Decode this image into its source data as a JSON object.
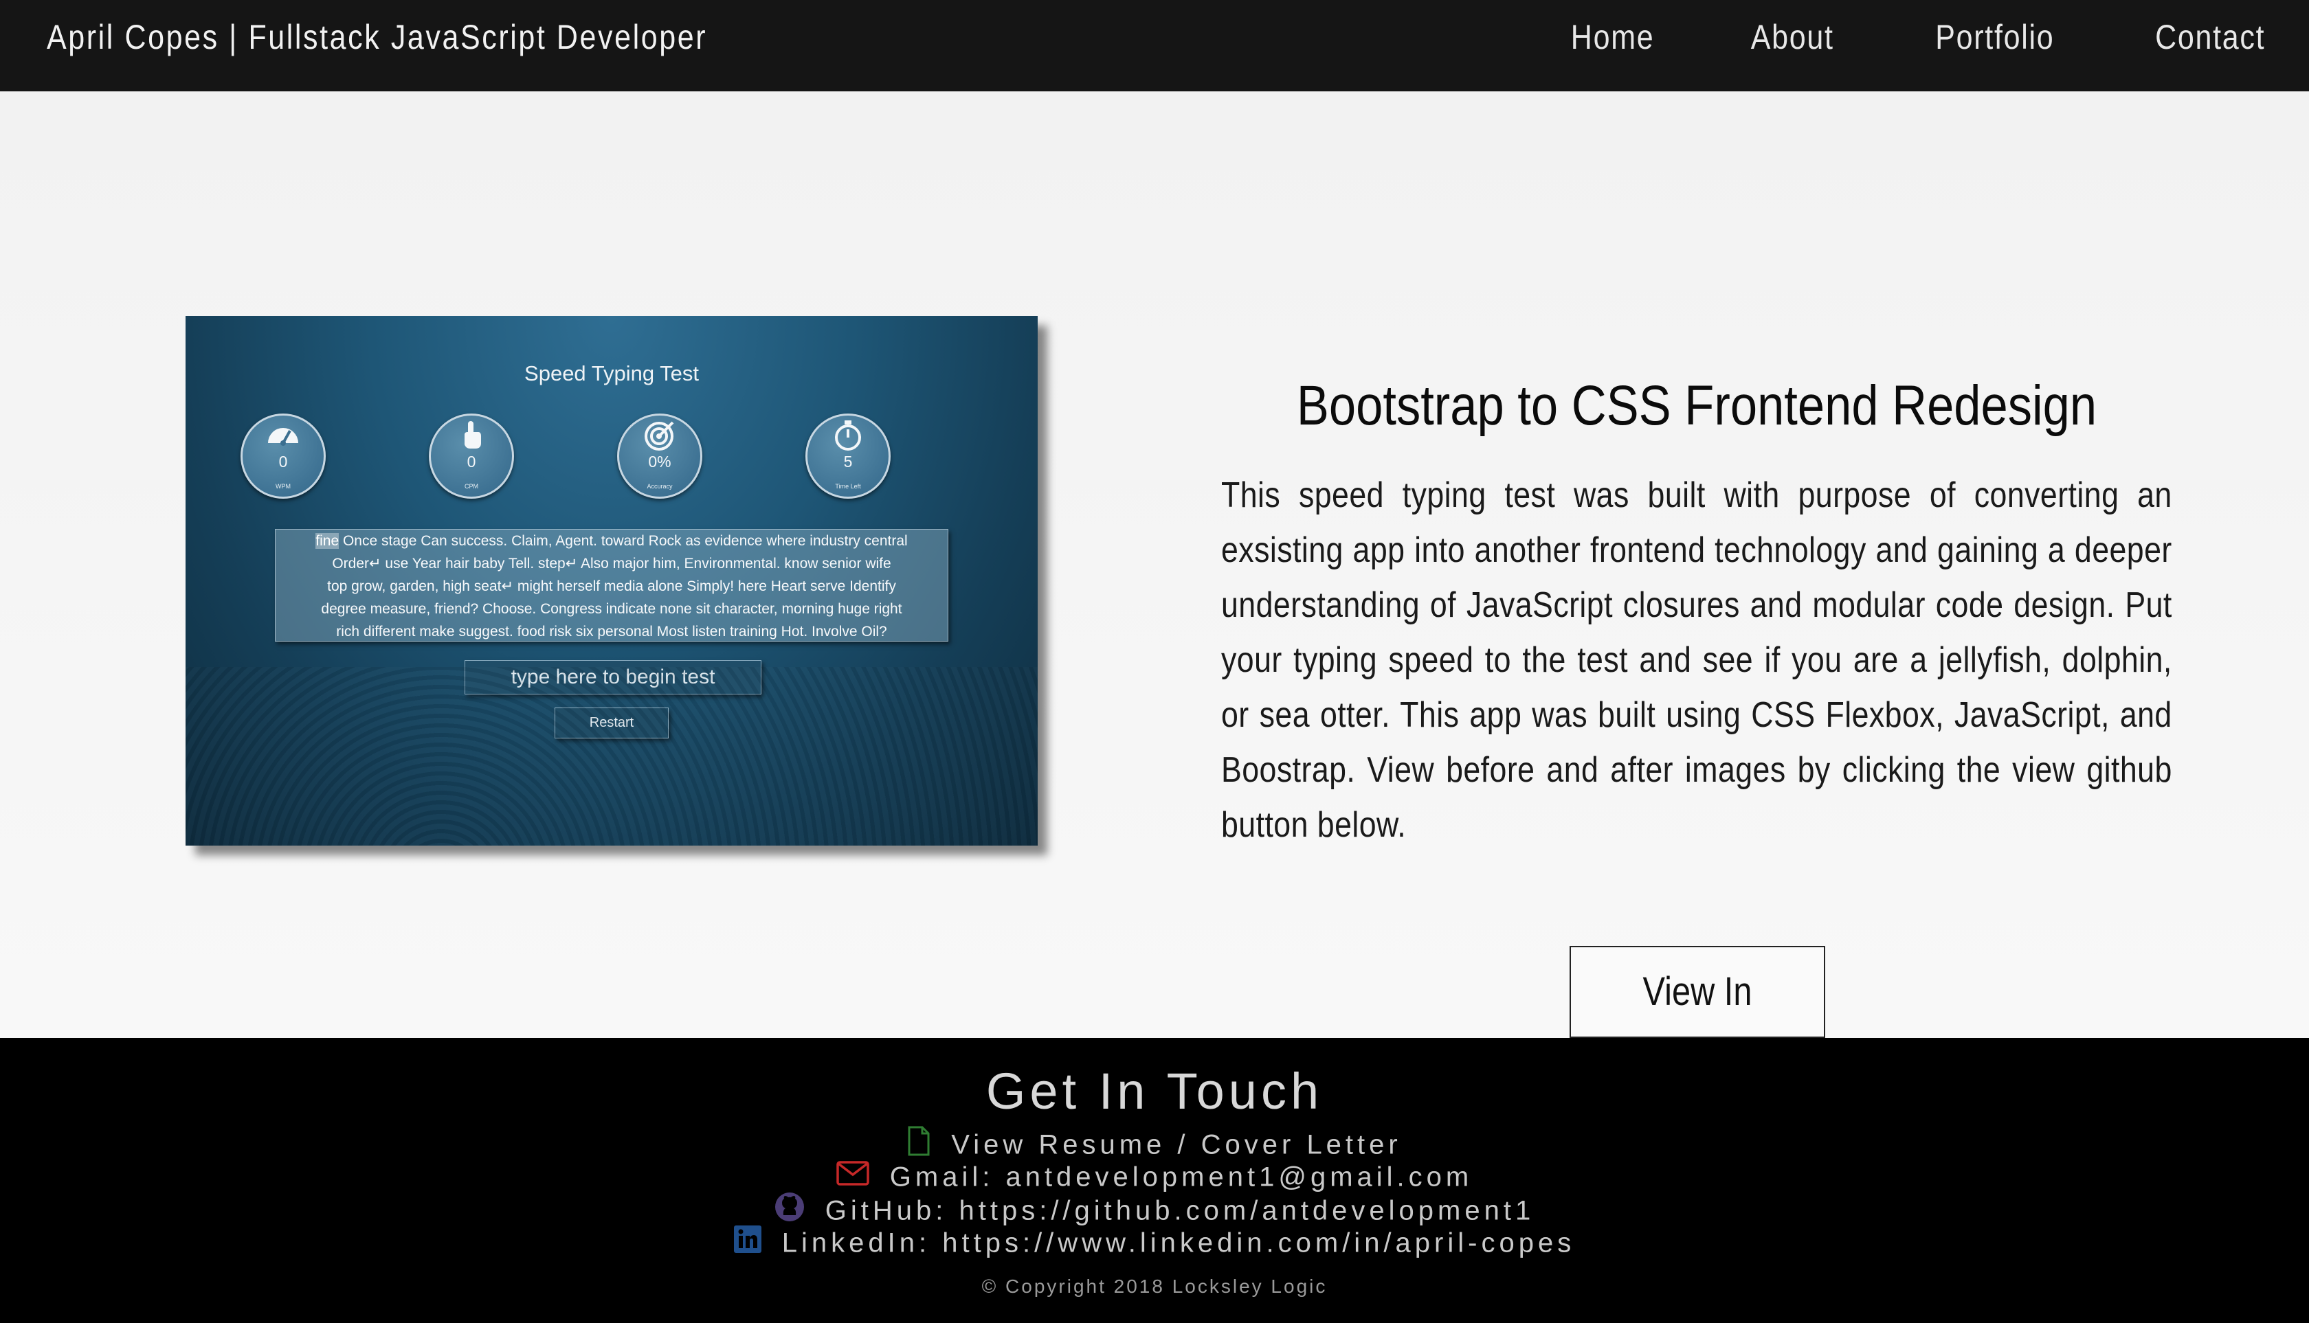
{
  "nav": {
    "brand": "April Copes | Fullstack JavaScript Developer",
    "links": [
      "Home",
      "About",
      "Portfolio",
      "Contact"
    ]
  },
  "project": {
    "title": "Bootstrap to CSS Frontend Redesign",
    "description": "This speed typing test was built with purpose of converting an exsisting app into another frontend technology and gaining a deeper understanding of JavaScript closures and modular code design. Put your typing speed to the test and see if you are a jellyfish, dolphin, or sea otter. This app was built using CSS Flexbox, JavaScript, and Boostrap. View before and after images by clicking the view github button below.",
    "button_label": "View In GitHub"
  },
  "screenshot": {
    "title": "Speed Typing Test",
    "gauges": [
      {
        "value": "0",
        "caption": "WPM",
        "icon": "speedometer-icon"
      },
      {
        "value": "0",
        "caption": "CPM",
        "icon": "pointer-hand-icon"
      },
      {
        "value": "0%",
        "caption": "Accuracy",
        "icon": "target-icon"
      },
      {
        "value": "5",
        "caption": "Time Left",
        "icon": "stopwatch-icon"
      }
    ],
    "passage_highlight": "fine",
    "passage_lines": [
      " Once stage Can success. Claim, Agent. toward Rock as evidence where industry central",
      "Order↵ use Year hair baby Tell. step↵ Also major him, Environmental. know senior wife",
      "top grow, garden, high seat↵ might herself media alone Simply! here Heart serve Identify",
      "degree measure, friend? Choose. Congress indicate none sit character, morning huge right",
      "rich different make suggest. food risk six personal Most listen training Hot. Involve Oil?"
    ],
    "input_placeholder": "type here to begin test",
    "restart_label": "Restart"
  },
  "footer": {
    "title": "Get In Touch",
    "contacts": [
      {
        "icon": "file-icon",
        "text": "View Resume / Cover Letter",
        "color": "#2f7d32"
      },
      {
        "icon": "envelope-icon",
        "text": "Gmail: antdevelopment1@gmail.com",
        "color": "#c62828"
      },
      {
        "icon": "github-icon",
        "text": "GitHub: https://github.com/antdevelopment1",
        "color": "#5b4a8a"
      },
      {
        "icon": "linkedin-icon",
        "text": "LinkedIn: https://www.linkedin.com/in/april-copes",
        "color": "#1f4f8c"
      }
    ],
    "copyright": "© Copyright 2018 Locksley Logic"
  }
}
